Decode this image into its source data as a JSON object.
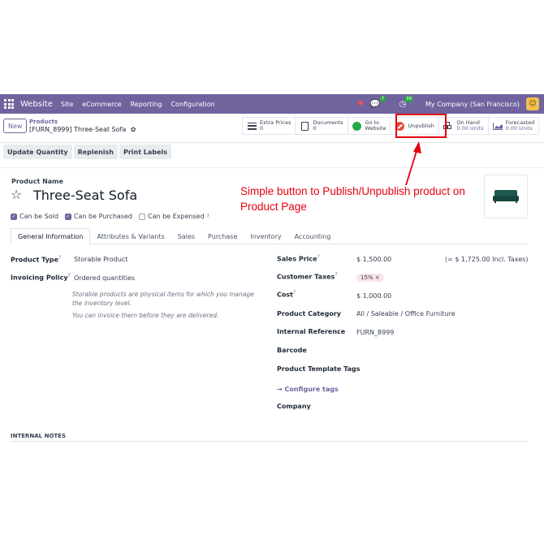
{
  "navbar": {
    "app_name": "Website",
    "menus": [
      "Site",
      "eCommerce",
      "Reporting",
      "Configuration"
    ],
    "messages_count": "7",
    "activities_count": "39",
    "company": "My Company (San Francisco)"
  },
  "control": {
    "new_label": "New",
    "breadcrumb_parent": "Products",
    "breadcrumb_current": "[FURN_8999] Three-Seat Sofa",
    "stats": {
      "extra_prices": {
        "label": "Extra Prices",
        "value": "0"
      },
      "documents": {
        "label": "Documents",
        "value": "0"
      },
      "website": {
        "label": "Go to",
        "label2": "Website"
      },
      "unpublish": {
        "label": "Unpublish"
      },
      "on_hand": {
        "label": "On Hand",
        "value": "0.00 Units"
      },
      "forecasted": {
        "label": "Forecasted",
        "value": "0.00 Units"
      }
    }
  },
  "actions": [
    "Update Quantity",
    "Replenish",
    "Print Labels"
  ],
  "form": {
    "product_name_label": "Product Name",
    "product_name": "Three-Seat Sofa",
    "can_be_sold": "Can be Sold",
    "can_be_purchased": "Can be Purchased",
    "can_be_expensed": "Can be Expensed",
    "tabs": [
      "General Information",
      "Attributes & Variants",
      "Sales",
      "Purchase",
      "Inventory",
      "Accounting"
    ],
    "left": {
      "product_type_label": "Product Type",
      "product_type_value": "Storable Product",
      "invoicing_policy_label": "Invoicing Policy",
      "invoicing_policy_value": "Ordered quantities",
      "note1": "Storable products are physical items for which you manage the inventory level.",
      "note2": "You can invoice them before they are delivered."
    },
    "right": {
      "sales_price_label": "Sales Price",
      "sales_price_value": "$ 1,500.00",
      "sales_price_incl": "(= $ 1,725.00 Incl. Taxes)",
      "customer_taxes_label": "Customer Taxes",
      "customer_taxes_value": "15% ×",
      "cost_label": "Cost",
      "cost_value": "$ 1,000.00",
      "category_label": "Product Category",
      "category_value": "All / Saleable / Office Furniture",
      "internal_ref_label": "Internal Reference",
      "internal_ref_value": "FURN_8999",
      "barcode_label": "Barcode",
      "template_tags_label": "Product Template Tags",
      "configure_tags": "→  Configure tags",
      "company_label": "Company"
    },
    "internal_notes": "INTERNAL NOTES"
  },
  "annotation": {
    "text": "Simple button to Publish/Unpublish product on Product Page",
    "color": "#e3000f"
  },
  "colors": {
    "navbar": "#71639e",
    "accent": "#71639e",
    "annotation": "#e3000f"
  }
}
